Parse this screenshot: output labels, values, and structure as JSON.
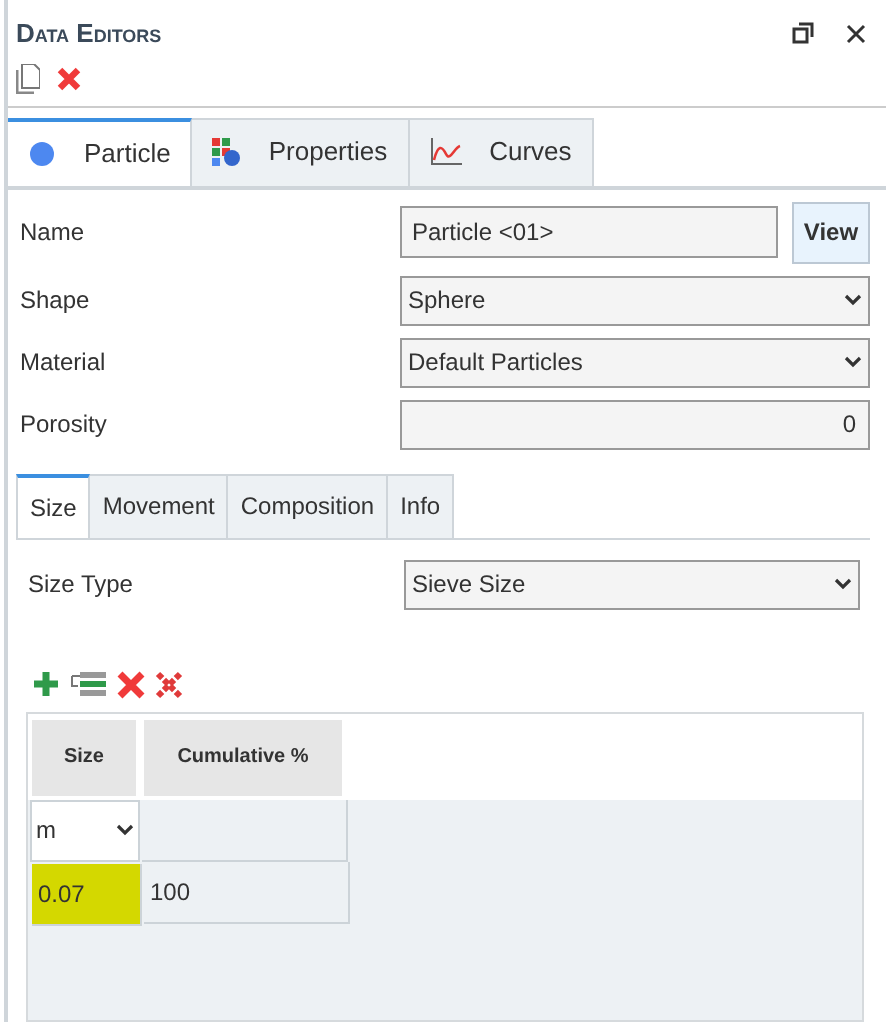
{
  "panel": {
    "title": "Data Editors"
  },
  "tabs": [
    {
      "label": "Particle",
      "selected": true
    },
    {
      "label": "Properties",
      "selected": false
    },
    {
      "label": "Curves",
      "selected": false
    }
  ],
  "fields": [
    {
      "label": "Name",
      "kind": "text",
      "value": "Particle <01>",
      "button": "View"
    },
    {
      "label": "Shape",
      "kind": "select",
      "value": "Sphere"
    },
    {
      "label": "Material",
      "kind": "select",
      "value": "Default Particles"
    },
    {
      "label": "Porosity",
      "kind": "number",
      "value": "0"
    }
  ],
  "subtabs": [
    {
      "label": "Size",
      "selected": true
    },
    {
      "label": "Movement",
      "selected": false
    },
    {
      "label": "Composition",
      "selected": false
    },
    {
      "label": "Info",
      "selected": false
    }
  ],
  "size_type": {
    "label": "Size Type",
    "value": "Sieve Size"
  },
  "table": {
    "columns": [
      "Size",
      "Cumulative %"
    ],
    "unit": "m",
    "rows": [
      {
        "cells": [
          {
            "text": "0.07",
            "selected": true
          },
          {
            "text": "100",
            "selected": false
          }
        ]
      }
    ]
  }
}
